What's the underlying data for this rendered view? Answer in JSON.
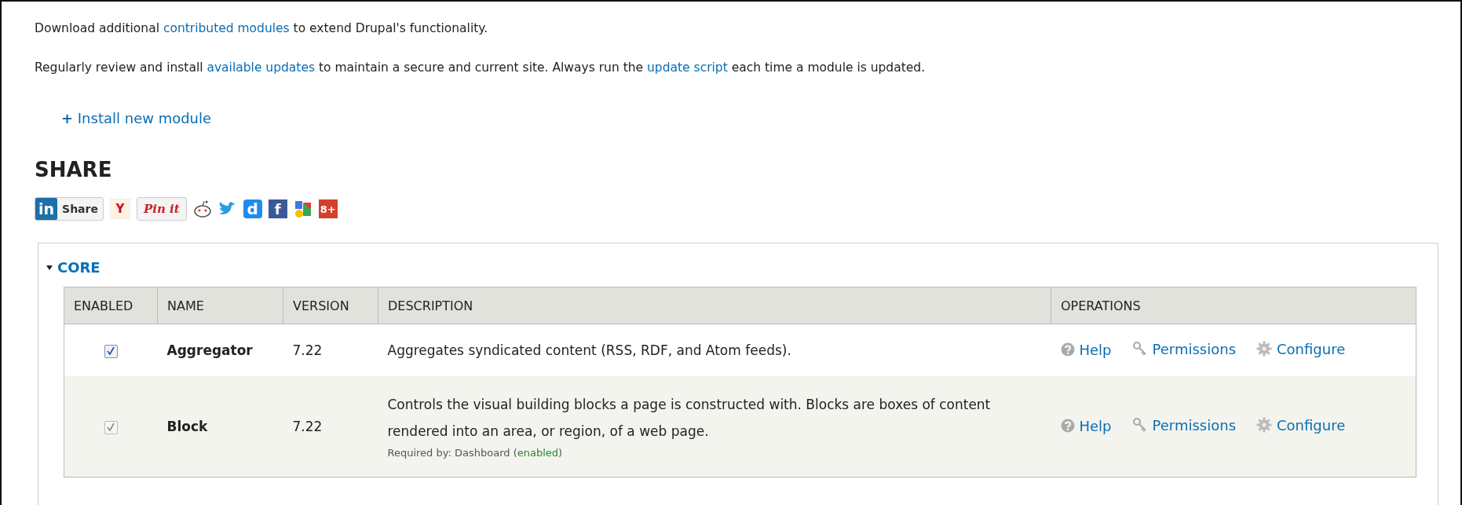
{
  "intro": [
    [
      {
        "kind": "text",
        "text": "Download additional "
      },
      {
        "kind": "link",
        "text": "contributed modules"
      },
      {
        "kind": "text",
        "text": " to extend Drupal's functionality."
      }
    ],
    [
      {
        "kind": "text",
        "text": "Regularly review and install "
      },
      {
        "kind": "link",
        "text": "available updates"
      },
      {
        "kind": "text",
        "text": " to maintain a secure and current site. Always run the "
      },
      {
        "kind": "link",
        "text": "update script"
      },
      {
        "kind": "text",
        "text": " each time a module is updated."
      }
    ]
  ],
  "action_link": {
    "icon": "+",
    "label": "Install new module"
  },
  "share": {
    "title": "SHARE",
    "buttons": [
      {
        "kind": "linkedin",
        "logo": "in",
        "label": "Share"
      },
      {
        "kind": "yahoo",
        "logo": "Y"
      },
      {
        "kind": "pinterest",
        "label": "Pin it"
      },
      {
        "kind": "reddit"
      },
      {
        "kind": "twitter"
      },
      {
        "kind": "digg",
        "logo": "d"
      },
      {
        "kind": "facebook",
        "logo": "f"
      },
      {
        "kind": "google"
      },
      {
        "kind": "gplus",
        "logo": "8+"
      }
    ]
  },
  "fieldset": {
    "legend": "CORE",
    "expanded": true,
    "columns": [
      "ENABLED",
      "NAME",
      "VERSION",
      "DESCRIPTION",
      "OPERATIONS"
    ],
    "rows": [
      {
        "enabled": true,
        "disabled": false,
        "name": "Aggregator",
        "version": "7.22",
        "description": "Aggregates syndicated content (RSS, RDF, and Atom feeds).",
        "operations": [
          {
            "kind": "help",
            "label": "Help"
          },
          {
            "kind": "permissions",
            "label": "Permissions"
          },
          {
            "kind": "configure",
            "label": "Configure"
          }
        ]
      },
      {
        "enabled": true,
        "disabled": true,
        "name": "Block",
        "version": "7.22",
        "description": "Controls the visual building blocks a page is constructed with. Blocks are boxes of content rendered into an area, or region, of a web page.",
        "required_by": {
          "prefix": "Required by: Dashboard (",
          "status": "enabled",
          "suffix": ")"
        },
        "operations": [
          {
            "kind": "help",
            "label": "Help"
          },
          {
            "kind": "permissions",
            "label": "Permissions"
          },
          {
            "kind": "configure",
            "label": "Configure"
          }
        ]
      }
    ]
  }
}
